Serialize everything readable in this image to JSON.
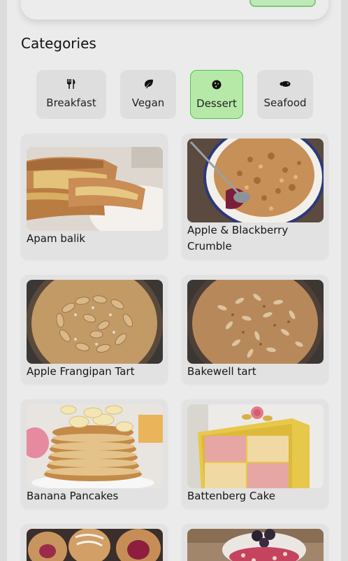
{
  "section_title": "Categories",
  "categories": [
    {
      "label": "Breakfast",
      "icon": "utensils-icon",
      "active": false
    },
    {
      "label": "Vegan",
      "icon": "leaf-icon",
      "active": false
    },
    {
      "label": "Dessert",
      "icon": "cookie-icon",
      "active": true
    },
    {
      "label": "Seafood",
      "icon": "fish-icon",
      "active": false
    }
  ],
  "meals": [
    {
      "title": "Apam balik"
    },
    {
      "title": "Apple & Blackberry Crumble"
    },
    {
      "title": "Apple Frangipan Tart"
    },
    {
      "title": "Bakewell tart"
    },
    {
      "title": "Banana Pancakes"
    },
    {
      "title": "Battenberg Cake"
    }
  ],
  "colors": {
    "accent": "#b6e9a8",
    "accent_border": "#4fc34a",
    "background": "#ebebeb",
    "card": "#e2e2e2"
  }
}
